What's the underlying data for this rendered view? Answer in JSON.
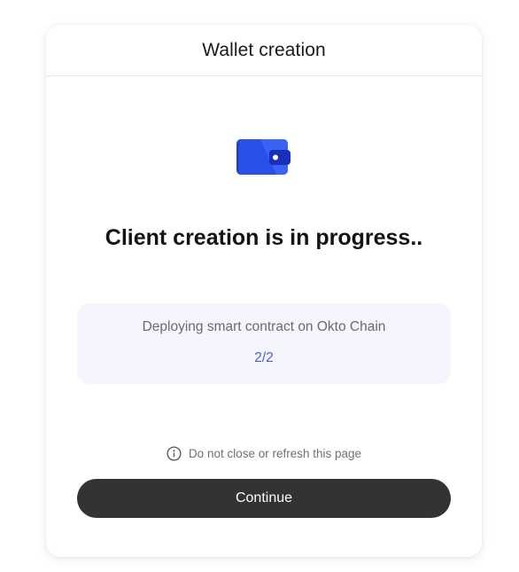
{
  "header": {
    "title": "Wallet creation"
  },
  "main": {
    "icon": "wallet-icon",
    "heading": "Client creation is in progress..",
    "status": {
      "text": "Deploying smart contract on Okto Chain",
      "count": "2/2"
    },
    "notice": {
      "icon": "info-icon",
      "text": "Do not close or refresh this page"
    },
    "continue_label": "Continue"
  },
  "colors": {
    "button_bg": "#333333",
    "status_bg": "#f4f5fd",
    "count_text": "#4a5fd0",
    "wallet_blue": "#2f55f0"
  }
}
